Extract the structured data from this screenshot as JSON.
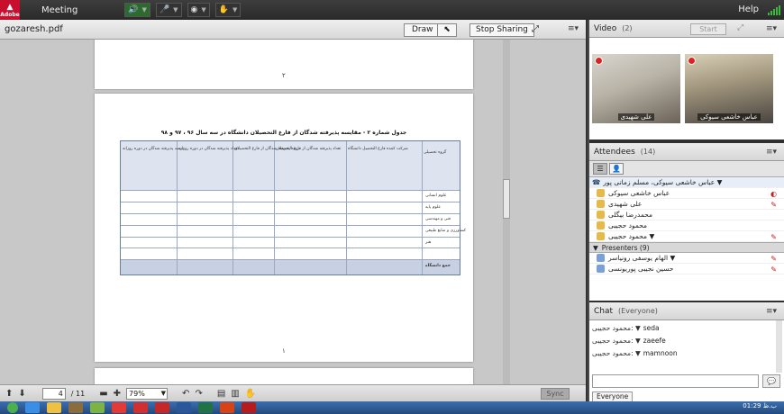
{
  "topbar": {
    "logo_text": "Adobe",
    "menu_label": "Meeting",
    "help_label": "Help"
  },
  "share_pod": {
    "file_title": "gozaresh.pdf",
    "draw_label": "Draw",
    "stop_sharing_label": "Stop Sharing",
    "pod_menu_icon": "≡▾",
    "page_above_number": "۲",
    "page_number": "۱",
    "table_caption": "جدول شماره ۲ - مقایسه پذیرفته شدگان از فارغ التحصیلان دانشگاه در سه سال ۹۶ ، ۹۷ و ۹۸",
    "current_page": "4",
    "total_pages": "/ 11",
    "zoom_value": "79%",
    "sync_label": "Sync",
    "table": {
      "header_groups": [
        "درصد پذیرفته شدگان در دوره روزانه",
        "تعداد پذیرفته شدگان در دوره روزانه",
        "درصد پذیرفته شدگان از فارغ التحصیلان",
        "تعداد پذیرفته شدگان از فارغ التحصیلان",
        "شرکت کننده فارغ التحصیل دانشگاه",
        "گروه تحصیلی"
      ],
      "row_labels": [
        "علوم انسانی",
        "علوم پایه",
        "فنی و مهندسی",
        "کشاورزی و منابع طبیعی",
        "هنر",
        "جمع دانشگاه"
      ]
    }
  },
  "video_pod": {
    "title": "Video",
    "count": "(2)",
    "start_label": "Start",
    "participant1": "علی شهیدی",
    "participant2": "عباس خاشعی سیوکی"
  },
  "attendees_pod": {
    "title": "Attendees",
    "count": "(14)",
    "host_row": "عباس خاشعی سیوکی، مسلم زمانی پور ▼",
    "hosts": [
      "عباس خاشعی سیوکی",
      "علی شهیدی",
      "محمدرضا بیگلی",
      "محمود حجیبی",
      "محمود حجیبی ▼"
    ],
    "presenters_label": "Presenters (9)",
    "presenters": [
      "الهام یوسفی رونیاسر ▼",
      "حسین نجیبی پوریونسی"
    ]
  },
  "chat_pod": {
    "title": "Chat",
    "scope": "(Everyone)",
    "messages": [
      {
        "who": "محمود حجیبی: ▼",
        "text": "seda"
      },
      {
        "who": "محمود حجیبی: ▼",
        "text": "zaeefe"
      },
      {
        "who": "محمود حجیبی: ▼",
        "text": "mamnoon"
      }
    ],
    "tab_label": "Everyone"
  },
  "taskbar": {
    "clock": "01:29 ب.ظ"
  },
  "colors": {
    "chrome_dark": "#2f2f2f",
    "table_header": "#dde4f0",
    "table_total": "#c7d1e3",
    "record_red": "#dd2222"
  }
}
